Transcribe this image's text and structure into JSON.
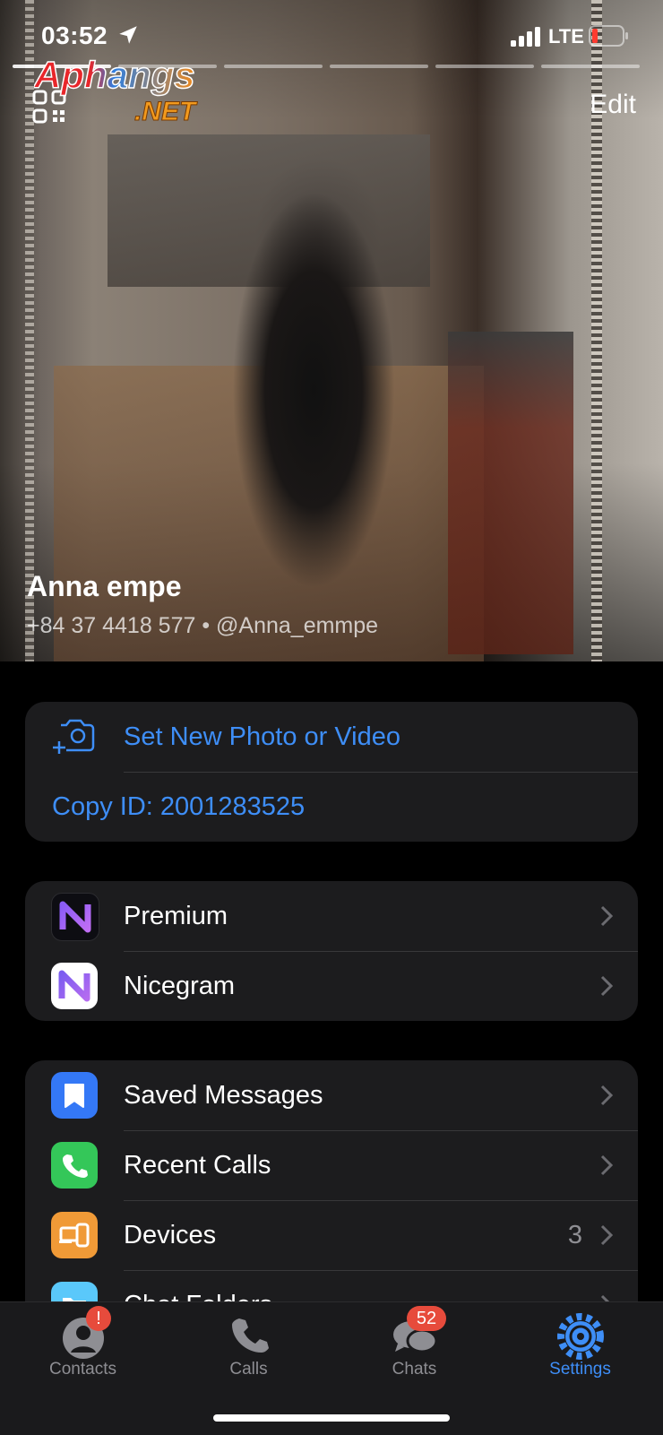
{
  "status_bar": {
    "time": "03:52",
    "network": "LTE"
  },
  "header": {
    "edit_label": "Edit",
    "watermark_line1": "Aphangs",
    "watermark_line2": ".NET"
  },
  "profile": {
    "name": "Anna empe",
    "subtitle": "+84 37 4418 577 • @Anna_emmpe"
  },
  "photo_group": {
    "set_photo_label": "Set New Photo or Video",
    "copy_id_label": "Copy ID: 2001283525"
  },
  "app_group": [
    {
      "label": "Premium",
      "icon": "nicegram-premium-icon"
    },
    {
      "label": "Nicegram",
      "icon": "nicegram-icon"
    }
  ],
  "main_group": [
    {
      "label": "Saved Messages",
      "icon": "bookmark-icon",
      "color": "#3478f6"
    },
    {
      "label": "Recent Calls",
      "icon": "phone-icon",
      "color": "#34c759"
    },
    {
      "label": "Devices",
      "icon": "devices-icon",
      "color": "#f09a37",
      "value": "3"
    },
    {
      "label": "Chat Folders",
      "icon": "folder-icon",
      "color": "#5ac8fa"
    }
  ],
  "tabbar": {
    "tabs": [
      {
        "label": "Contacts",
        "badge": "!"
      },
      {
        "label": "Calls"
      },
      {
        "label": "Chats",
        "badge": "52"
      },
      {
        "label": "Settings",
        "active": true
      }
    ]
  },
  "colors": {
    "accent": "#3e8ef7",
    "badge": "#e74b3c",
    "cell_bg": "#1c1c1e"
  }
}
